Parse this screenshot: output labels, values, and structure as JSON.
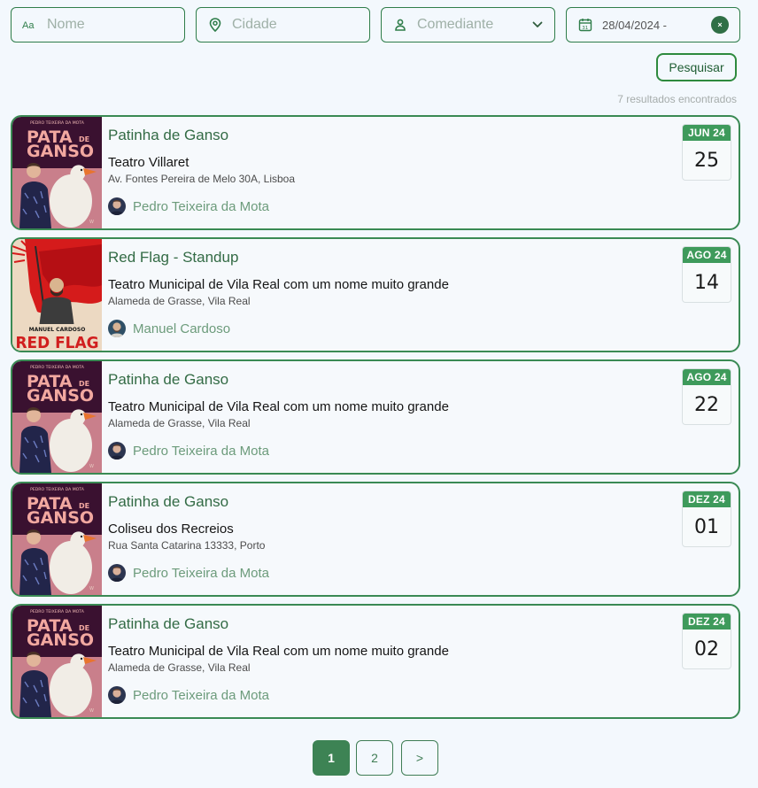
{
  "filters": {
    "name_placeholder": "Nome",
    "city_placeholder": "Cidade",
    "category_value": "Comediante",
    "date_value": "28/04/2024 -",
    "clear_label": "×"
  },
  "search_label": "Pesquisar",
  "results_text": "7 resultados encontrados",
  "shows": [
    {
      "title": "Patinha de Ganso",
      "venue": "Teatro Villaret",
      "address": "Av. Fontes Pereira de Melo 30A, Lisboa",
      "artist": "Pedro Teixeira da Mota",
      "month": "JUN 24",
      "day": "25",
      "poster": "pata-de-ganso"
    },
    {
      "title": "Red Flag - Standup",
      "venue": "Teatro Municipal de Vila Real com um nome muito grande",
      "address": "Alameda de Grasse, Vila Real",
      "artist": "Manuel Cardoso",
      "month": "AGO 24",
      "day": "14",
      "poster": "red-flag"
    },
    {
      "title": "Patinha de Ganso",
      "venue": "Teatro Municipal de Vila Real com um nome muito grande",
      "address": "Alameda de Grasse, Vila Real",
      "artist": "Pedro Teixeira da Mota",
      "month": "AGO 24",
      "day": "22",
      "poster": "pata-de-ganso"
    },
    {
      "title": "Patinha de Ganso",
      "venue": "Coliseu dos Recreios",
      "address": "Rua Santa Catarina 13333, Porto",
      "artist": "Pedro Teixeira da Mota",
      "month": "DEZ 24",
      "day": "01",
      "poster": "pata-de-ganso"
    },
    {
      "title": "Patinha de Ganso",
      "venue": "Teatro Municipal de Vila Real com um nome muito grande",
      "address": "Alameda de Grasse, Vila Real",
      "artist": "Pedro Teixeira da Mota",
      "month": "DEZ 24",
      "day": "02",
      "poster": "pata-de-ganso"
    }
  ],
  "posters": {
    "pata": {
      "top_line": "PEDRO TEIXEIRA DA MOTA",
      "word1": "PATA",
      "word2": "DE",
      "word3": "GANSO"
    },
    "redflag": {
      "name_line": "MANUEL CARDOSO",
      "word": "RED FLAG"
    }
  },
  "pagination": {
    "page1": "1",
    "page2": "2",
    "next": ">"
  },
  "colors": {
    "accent": "#3d8354",
    "border": "#3a8a54",
    "month_badge": "#3e9a5b"
  }
}
